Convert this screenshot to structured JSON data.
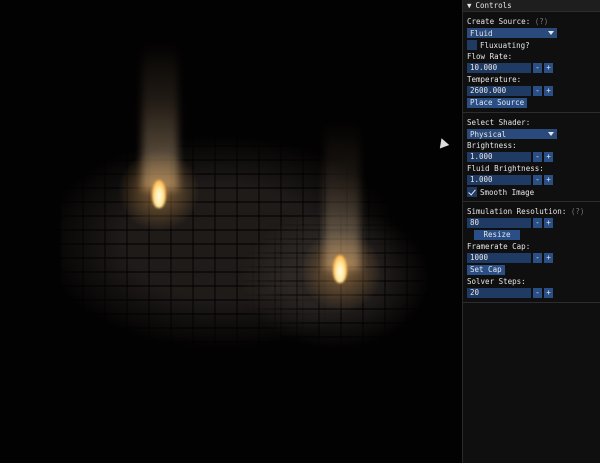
{
  "panel": {
    "title": "Controls",
    "create_source": {
      "label": "Create Source:",
      "hint": "(?)",
      "selected": "Fluid",
      "fluxuating_label": "Fluxuating?",
      "fluxuating_checked": false,
      "flow_rate_label": "Flow Rate:",
      "flow_rate_value": "10.000",
      "temperature_label": "Temperature:",
      "temperature_value": "2600.000",
      "place_button": "Place Source"
    },
    "shader": {
      "label": "Select Shader:",
      "selected": "Physical",
      "brightness_label": "Brightness:",
      "brightness_value": "1.000",
      "fluid_brightness_label": "Fluid Brightness:",
      "fluid_brightness_value": "1.000",
      "smooth_label": "Smooth Image",
      "smooth_checked": true
    },
    "simulation": {
      "resolution_label": "Simulation Resolution:",
      "hint": "(?)",
      "resolution_value": "80",
      "resize_button": "Resize",
      "framerate_label": "Framerate Cap:",
      "framerate_value": "1000",
      "set_cap_button": "Set Cap",
      "solver_label": "Solver Steps:",
      "solver_value": "20"
    },
    "stepper_minus": "-",
    "stepper_plus": "+"
  },
  "icons": {
    "collapse": "triangle-down-icon",
    "dropdown": "chevron-down-icon",
    "check": "checkmark-icon",
    "cursor": "mouse-pointer-icon"
  },
  "colors": {
    "panel_bg": "#0f0f10",
    "widget_bg": "#1f3a63",
    "button_bg": "#2a4f86",
    "flame_core": "#fff4d0",
    "flame_glow": "#ffb347"
  }
}
